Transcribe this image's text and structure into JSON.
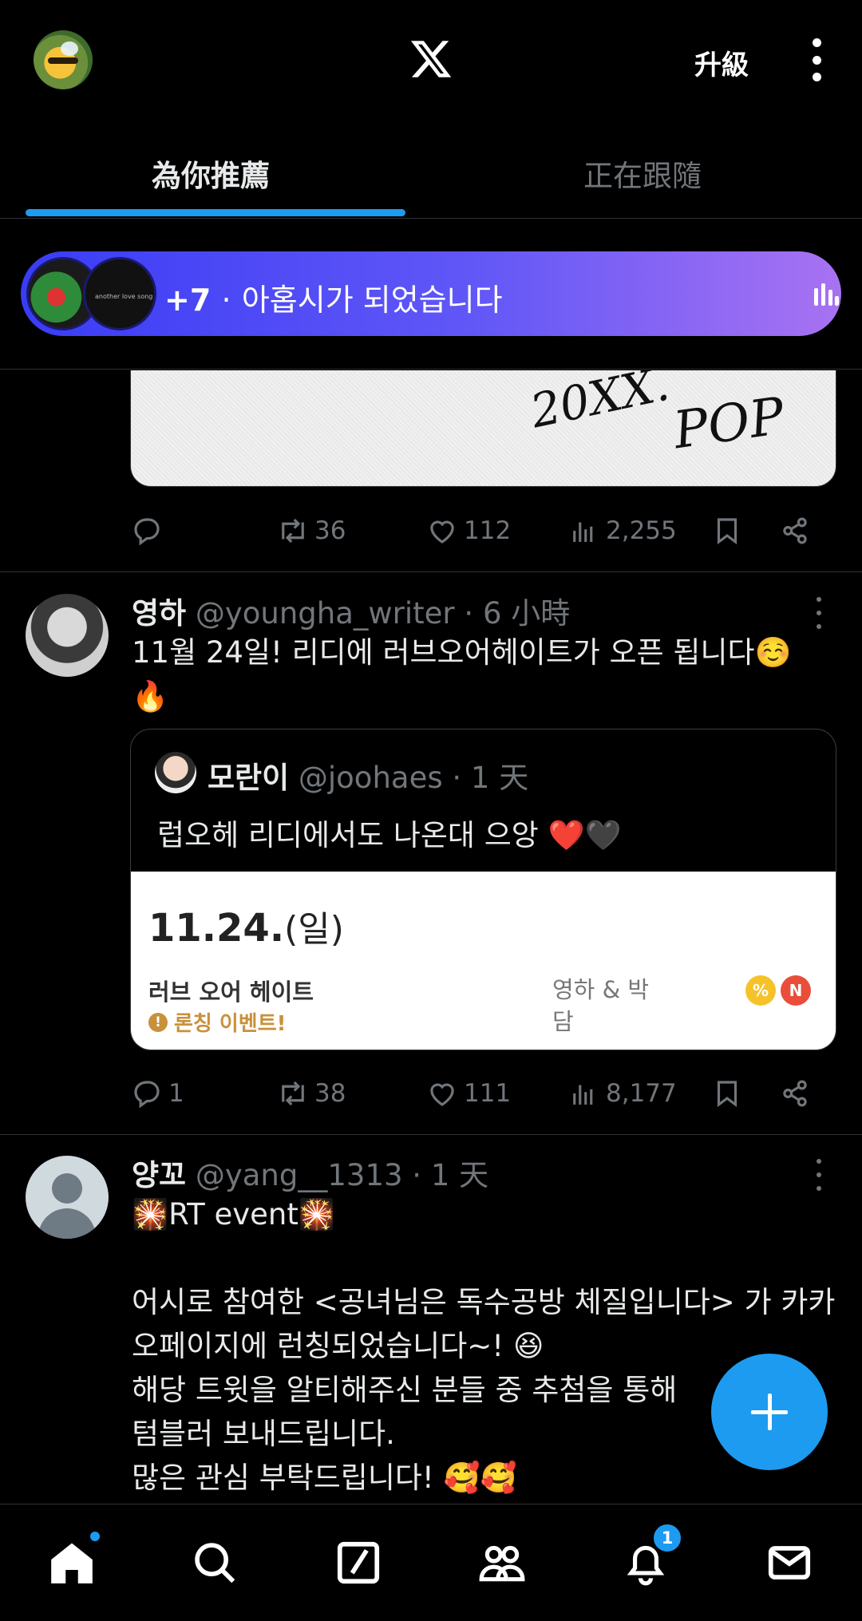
{
  "header": {
    "upgrade_label": "升級",
    "tabs": [
      {
        "label": "為你推薦",
        "active": true
      },
      {
        "label": "正在跟隨",
        "active": false
      }
    ]
  },
  "spaces_banner": {
    "count": "+7",
    "separator": "·",
    "title": "아홉시가 되었습니다",
    "avatar2_text": "another love song"
  },
  "tweet0": {
    "media_scrawl_1": "20XX.",
    "media_scrawl_2": "POP",
    "actions": {
      "replies": "",
      "retweets": "36",
      "likes": "112",
      "views": "2,255"
    }
  },
  "tweet1": {
    "name": "영하",
    "handle": "@youngha_writer",
    "sep": "·",
    "time": "6 小時",
    "text": "11월 24일! 리디에 러브오어헤이트가 오픈 됩니다☺️\n🔥",
    "quote": {
      "name": "모란이",
      "handle": "@joohaes",
      "sep": "·",
      "time": "1 天",
      "text": "럽오헤 리디에서도 나온대 으앙 ❤️🖤",
      "card": {
        "date": "11.24.",
        "day": "(일)",
        "title": "러브 오어 헤이트",
        "event": "론칭 이벤트!",
        "author": "영하 & 박담",
        "badge1": "%",
        "badge2": "N"
      }
    },
    "actions": {
      "replies": "1",
      "retweets": "38",
      "likes": "111",
      "views": "8,177"
    }
  },
  "tweet2": {
    "name": "양꼬",
    "handle": "@yang__1313",
    "sep": "·",
    "time": "1 天",
    "text": "🎇RT event🎇\n\n어시로 참여한 <공녀님은 독수공방 체질입니다> 가 카카오페이지에 런칭되었습니다~! 😆\n해당 트윗을 알티해주신 분들 중 추첨을 통해\n텀블러 보내드립니다.\n많은 관심 부탁드립니다! 🥰🥰"
  },
  "bottom_nav": {
    "notifications_count": "1",
    "items": [
      "home-icon",
      "search-icon",
      "grok-icon",
      "communities-icon",
      "notifications-icon",
      "messages-icon"
    ]
  },
  "colors": {
    "accent": "#1d9bf0",
    "background": "#000000",
    "muted": "#71767b"
  }
}
